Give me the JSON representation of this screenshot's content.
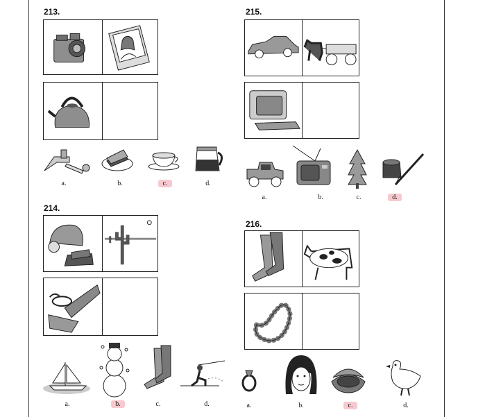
{
  "questions": [
    {
      "number": "213.",
      "row1": [
        "camera-icon",
        "portrait-photo-icon"
      ],
      "row2": [
        "kettle-icon",
        ""
      ],
      "options": [
        {
          "letter": "a.",
          "icon": "faucet-icon",
          "highlighted": false
        },
        {
          "letter": "b.",
          "icon": "cake-slice-icon",
          "highlighted": false
        },
        {
          "letter": "c.",
          "icon": "teacup-icon",
          "highlighted": true
        },
        {
          "letter": "d.",
          "icon": "coffee-pot-icon",
          "highlighted": false
        }
      ]
    },
    {
      "number": "214.",
      "row1": [
        "winter-hat-gloves-icon",
        "desert-cactus-icon"
      ],
      "row2": [
        "snorkel-flippers-icon",
        ""
      ],
      "options": [
        {
          "letter": "a.",
          "icon": "sailboat-icon",
          "highlighted": false
        },
        {
          "letter": "b.",
          "icon": "snowman-icon",
          "highlighted": true
        },
        {
          "letter": "c.",
          "icon": "boots-icon",
          "highlighted": false
        },
        {
          "letter": "d.",
          "icon": "water-skier-icon",
          "highlighted": false
        }
      ]
    },
    {
      "number": "215.",
      "row1": [
        "modern-car-icon",
        "horse-wagon-icon"
      ],
      "row2": [
        "computer-icon",
        ""
      ],
      "options": [
        {
          "letter": "a.",
          "icon": "old-car-icon",
          "highlighted": false
        },
        {
          "letter": "b.",
          "icon": "old-television-icon",
          "highlighted": false
        },
        {
          "letter": "c.",
          "icon": "pine-tree-icon",
          "highlighted": false
        },
        {
          "letter": "d.",
          "icon": "ink-quill-icon",
          "highlighted": true
        }
      ]
    },
    {
      "number": "216.",
      "row1": [
        "boots-icon",
        "cow-icon"
      ],
      "row2": [
        "pearl-necklace-icon",
        ""
      ],
      "options": [
        {
          "letter": "a.",
          "icon": "ring-icon",
          "highlighted": false
        },
        {
          "letter": "b.",
          "icon": "woman-face-icon",
          "highlighted": false
        },
        {
          "letter": "c.",
          "icon": "oyster-icon",
          "highlighted": true
        },
        {
          "letter": "d.",
          "icon": "chicken-icon",
          "highlighted": false
        }
      ]
    }
  ],
  "colors": {
    "highlight": "#f7c9cf",
    "ink": "#222222",
    "fill": "#9a9a9a"
  }
}
